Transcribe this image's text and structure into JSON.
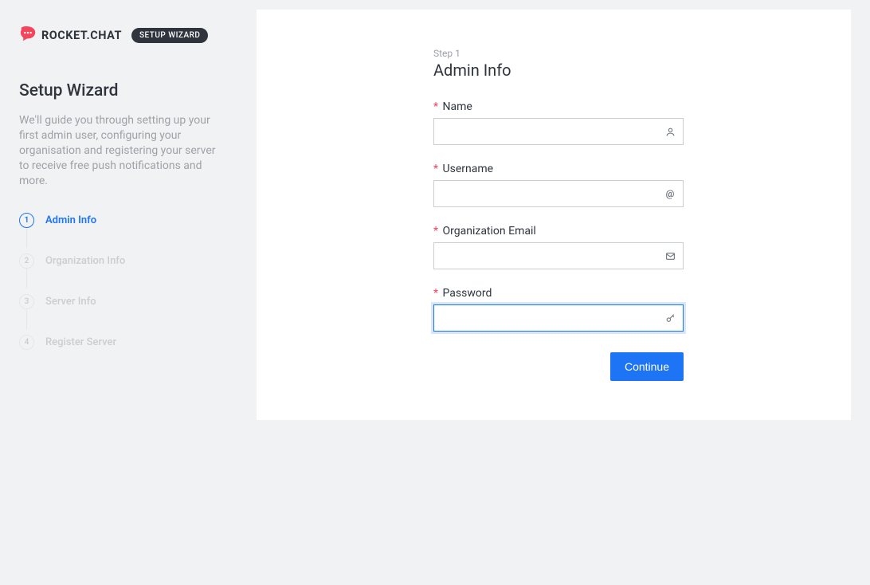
{
  "brand": {
    "name": "ROCKET.CHAT",
    "badge": "SETUP WIZARD"
  },
  "sidebar": {
    "title": "Setup Wizard",
    "description": "We'll guide you through setting up your first admin user, configuring your organisation and registering your server to receive free push notifications and more.",
    "steps": [
      {
        "num": "1",
        "label": "Admin Info",
        "active": true
      },
      {
        "num": "2",
        "label": "Organization Info",
        "active": false
      },
      {
        "num": "3",
        "label": "Server Info",
        "active": false
      },
      {
        "num": "4",
        "label": "Register Server",
        "active": false
      }
    ]
  },
  "form": {
    "step_label": "Step 1",
    "title": "Admin Info",
    "required_mark": "*",
    "fields": {
      "name": {
        "label": "Name",
        "value": ""
      },
      "username": {
        "label": "Username",
        "value": ""
      },
      "org_email": {
        "label": "Organization Email",
        "value": ""
      },
      "password": {
        "label": "Password",
        "value": ""
      }
    },
    "continue_label": "Continue"
  }
}
